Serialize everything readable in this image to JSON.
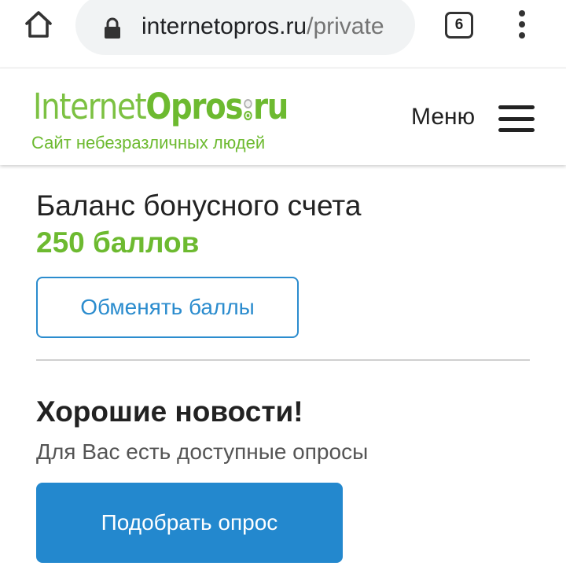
{
  "browser": {
    "home_icon": "home-icon",
    "lock_icon": "lock-icon",
    "url_domain": "internetopros.ru",
    "url_path": "/private",
    "tab_count": "6",
    "more_icon": "vertical-dots-icon"
  },
  "header": {
    "logo_part1": "Internet",
    "logo_part2": "Opros",
    "logo_part3": "ru",
    "tagline": "Сайт небезразличных людей",
    "menu_label": "Меню",
    "menu_icon": "hamburger-icon"
  },
  "balance": {
    "title": "Баланс бонусного счета",
    "value": "250 баллов",
    "exchange_button": "Обменять баллы"
  },
  "news": {
    "title": "Хорошие новости!",
    "subtitle": "Для Вас есть доступные опросы",
    "survey_button": "Подобрать опрос"
  },
  "colors": {
    "brand_green": "#6dba30",
    "link_blue": "#2b8cce",
    "button_blue": "#2388ce",
    "text_dark": "#222222"
  }
}
